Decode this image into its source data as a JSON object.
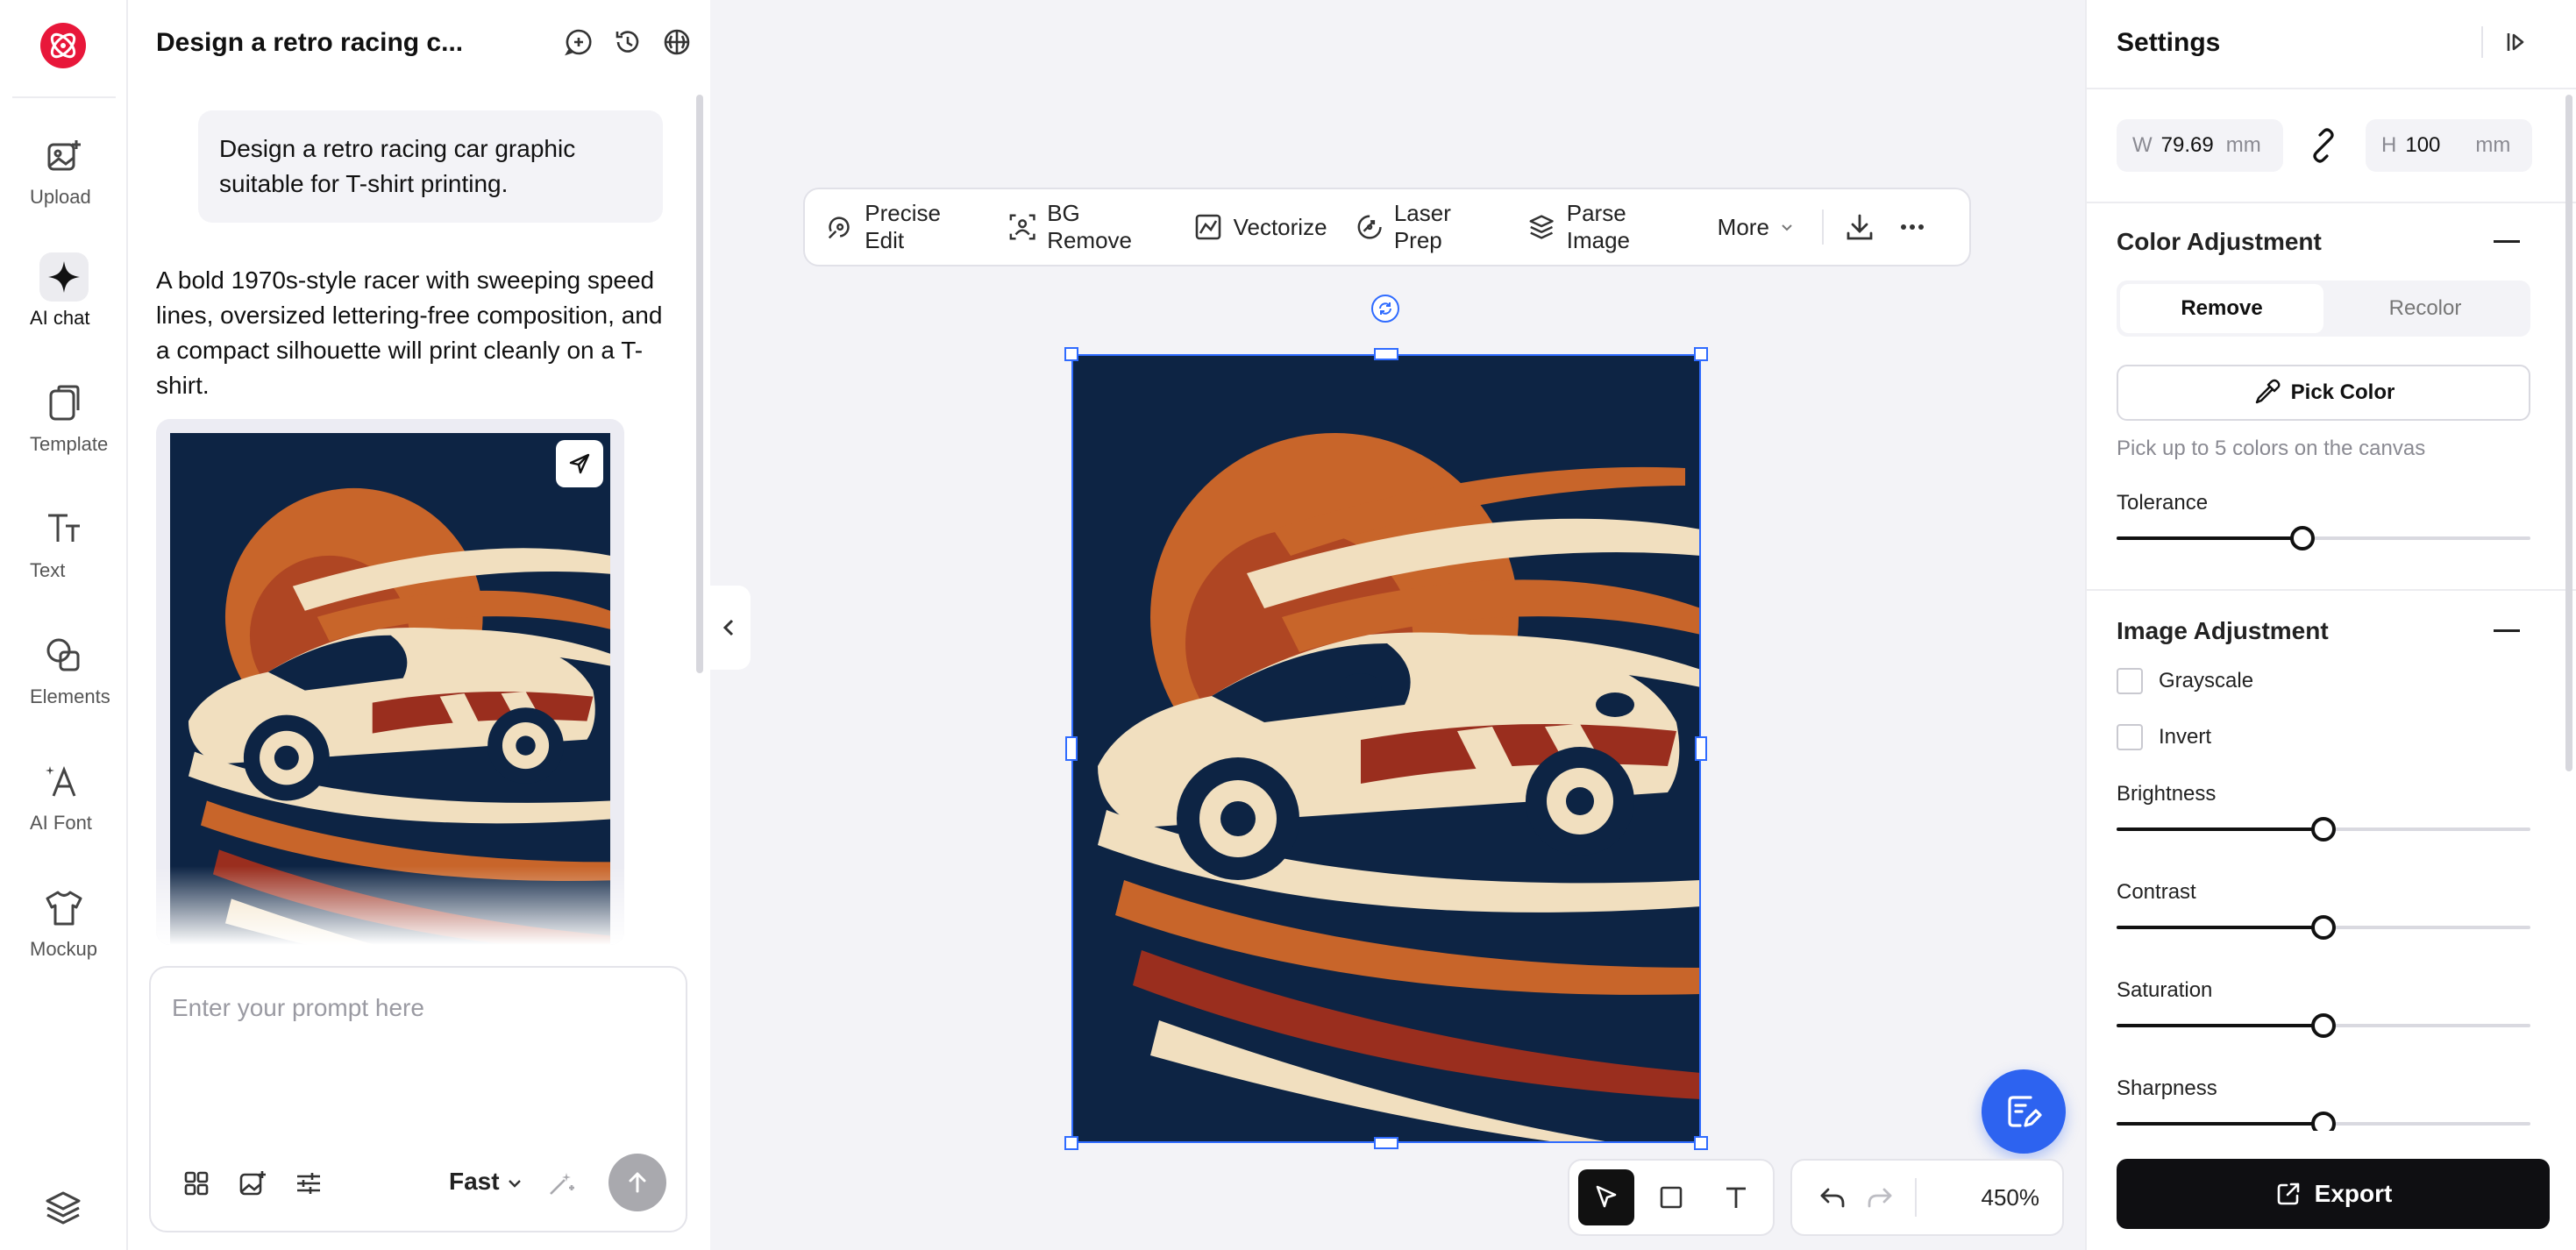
{
  "rail": {
    "items": [
      {
        "label": "Upload",
        "icon": "upload-image-icon"
      },
      {
        "label": "AI chat",
        "icon": "sparkle-icon"
      },
      {
        "label": "Template",
        "icon": "template-icon"
      },
      {
        "label": "Text",
        "icon": "text-icon"
      },
      {
        "label": "Elements",
        "icon": "shapes-icon"
      },
      {
        "label": "AI Font",
        "icon": "ai-font-icon"
      },
      {
        "label": "Mockup",
        "icon": "tshirt-icon"
      }
    ]
  },
  "chat": {
    "title": "Design a retro racing c...",
    "user_message": "Design a retro racing car graphic suitable for T-shirt printing.",
    "ai_message": "A bold 1970s-style racer with sweeping speed lines, oversized lettering-free composition, and a compact silhouette will print cleanly on a T-shirt.",
    "prompt_placeholder": "Enter your prompt here",
    "mode": "Fast"
  },
  "toolbar": {
    "items": [
      "Precise Edit",
      "BG Remove",
      "Vectorize",
      "Laser Prep",
      "Parse Image"
    ],
    "more": "More"
  },
  "canvas": {
    "zoom": "450%"
  },
  "settings": {
    "title": "Settings",
    "width_label": "W",
    "width_value": "79.69",
    "width_unit": "mm",
    "height_label": "H",
    "height_value": "100",
    "height_unit": "mm",
    "color_adjustment": {
      "title": "Color Adjustment",
      "tabs": [
        "Remove",
        "Recolor"
      ],
      "active_tab": "Remove",
      "pick_color": "Pick Color",
      "hint": "Pick up to 5 colors on the canvas",
      "tolerance_label": "Tolerance",
      "tolerance": 0.45
    },
    "image_adjustment": {
      "title": "Image Adjustment",
      "grayscale": "Grayscale",
      "invert": "Invert",
      "sliders": [
        {
          "label": "Brightness",
          "value": 0.5
        },
        {
          "label": "Contrast",
          "value": 0.5
        },
        {
          "label": "Saturation",
          "value": 0.5
        },
        {
          "label": "Sharpness",
          "value": 0.5
        }
      ]
    },
    "export": "Export"
  },
  "colors": {
    "brand": "#e8173a",
    "accent": "#2d63f0",
    "selection": "#2f6bff",
    "art_bg": "#0d2444",
    "art_orange": "#c8652a",
    "art_cream": "#f1dfbf",
    "art_red": "#9a2e1e"
  }
}
